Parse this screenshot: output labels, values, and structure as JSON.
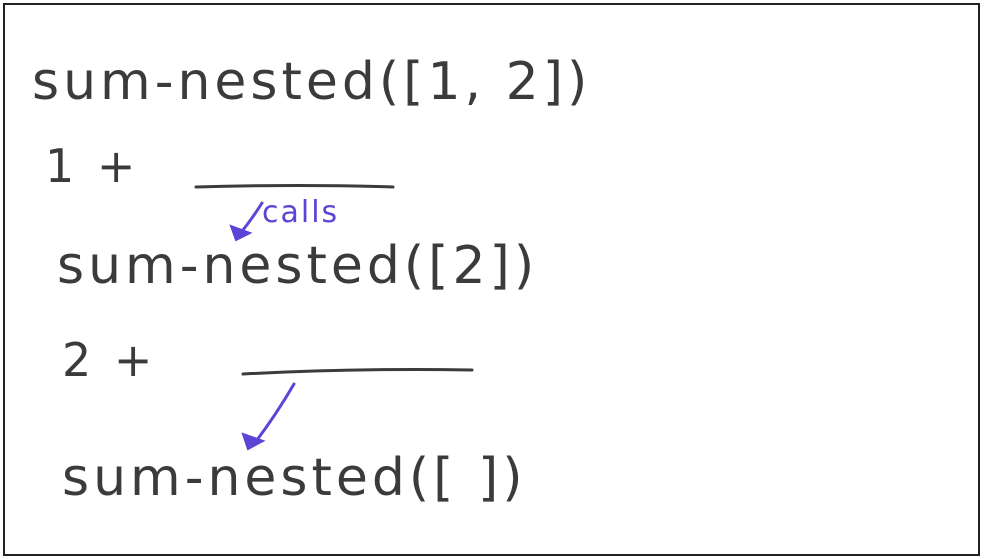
{
  "lines": {
    "call_1": "sum-nested([1, 2])",
    "expr_1": "1 +",
    "call_2": "sum-nested([2])",
    "expr_2": "2 +",
    "call_3": "sum-nested([ ])"
  },
  "annotation": {
    "calls_label": "calls"
  },
  "colors": {
    "ink": "#3b3b3b",
    "annotation": "#5b45d6",
    "border": "#222222"
  }
}
